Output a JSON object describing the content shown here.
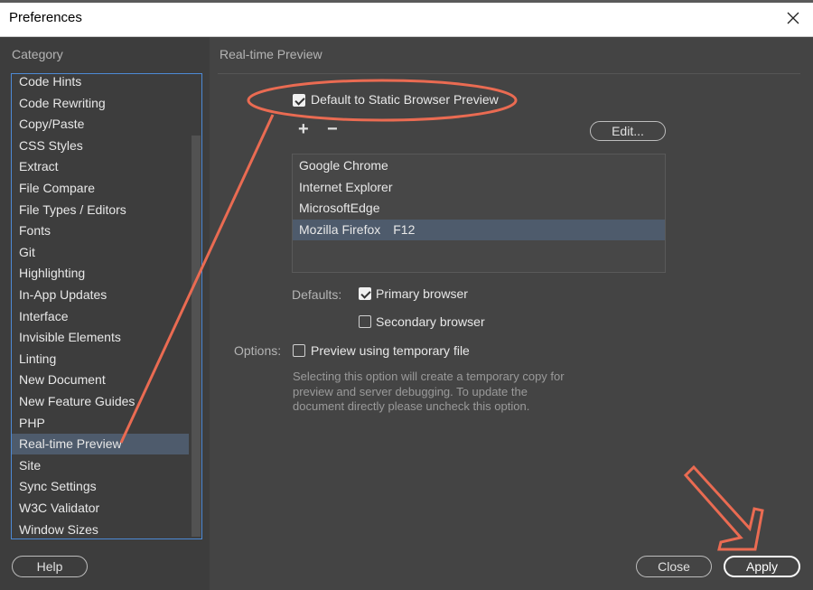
{
  "window": {
    "title": "Preferences"
  },
  "sidebar": {
    "heading": "Category",
    "items": [
      {
        "label": "Code Hints"
      },
      {
        "label": "Code Rewriting"
      },
      {
        "label": "Copy/Paste"
      },
      {
        "label": "CSS Styles"
      },
      {
        "label": "Extract"
      },
      {
        "label": "File Compare"
      },
      {
        "label": "File Types / Editors"
      },
      {
        "label": "Fonts"
      },
      {
        "label": "Git"
      },
      {
        "label": "Highlighting"
      },
      {
        "label": "In-App Updates"
      },
      {
        "label": "Interface"
      },
      {
        "label": "Invisible Elements"
      },
      {
        "label": "Linting"
      },
      {
        "label": "New Document"
      },
      {
        "label": "New Feature Guides"
      },
      {
        "label": "PHP"
      },
      {
        "label": "Real-time Preview"
      },
      {
        "label": "Site"
      },
      {
        "label": "Sync Settings"
      },
      {
        "label": "W3C Validator"
      },
      {
        "label": "Window Sizes"
      }
    ],
    "selected": "Real-time Preview"
  },
  "panel": {
    "title": "Real-time Preview",
    "static_preview": {
      "label": "Default to Static Browser Preview",
      "checked": true
    },
    "add_symbol": "+",
    "remove_symbol": "−",
    "edit_label": "Edit...",
    "browsers": [
      {
        "name": "Google Chrome",
        "shortcut": ""
      },
      {
        "name": "Internet Explorer",
        "shortcut": ""
      },
      {
        "name": "MicrosoftEdge",
        "shortcut": ""
      },
      {
        "name": "Mozilla Firefox",
        "shortcut": "F12"
      }
    ],
    "selected_browser": "Mozilla Firefox",
    "defaults_label": "Defaults:",
    "primary_browser": {
      "label": "Primary browser",
      "checked": true
    },
    "secondary_browser": {
      "label": "Secondary browser",
      "checked": false
    },
    "options_label": "Options:",
    "temp_file": {
      "label": "Preview using temporary file",
      "checked": false
    },
    "temp_file_desc": "Selecting this option will create a temporary copy for preview and server debugging. To update the document directly please uncheck this option."
  },
  "footer": {
    "help_label": "Help",
    "close_label": "Close",
    "apply_label": "Apply"
  },
  "colors": {
    "annotation": "#ea6b52",
    "selection": "#4e5b6c",
    "focus_border": "#4d8ad6"
  },
  "icons": {
    "close": "close-icon",
    "checkbox": "check-icon"
  }
}
